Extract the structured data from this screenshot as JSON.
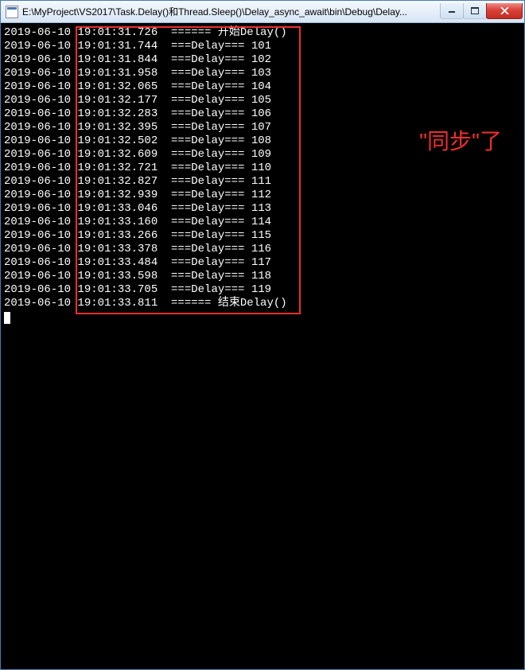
{
  "window": {
    "title": "E:\\MyProject\\VS2017\\Task.Delay()和Thread.Sleep()\\Delay_async_await\\bin\\Debug\\Delay..."
  },
  "annotation": "\"同步\"了",
  "console": {
    "lines": [
      "2019-06-10 19:01:31.726  ====== 开始Delay()",
      "2019-06-10 19:01:31.744  ===Delay=== 101",
      "2019-06-10 19:01:31.844  ===Delay=== 102",
      "2019-06-10 19:01:31.958  ===Delay=== 103",
      "2019-06-10 19:01:32.065  ===Delay=== 104",
      "2019-06-10 19:01:32.177  ===Delay=== 105",
      "2019-06-10 19:01:32.283  ===Delay=== 106",
      "2019-06-10 19:01:32.395  ===Delay=== 107",
      "2019-06-10 19:01:32.502  ===Delay=== 108",
      "2019-06-10 19:01:32.609  ===Delay=== 109",
      "2019-06-10 19:01:32.721  ===Delay=== 110",
      "2019-06-10 19:01:32.827  ===Delay=== 111",
      "2019-06-10 19:01:32.939  ===Delay=== 112",
      "2019-06-10 19:01:33.046  ===Delay=== 113",
      "2019-06-10 19:01:33.160  ===Delay=== 114",
      "2019-06-10 19:01:33.266  ===Delay=== 115",
      "2019-06-10 19:01:33.378  ===Delay=== 116",
      "2019-06-10 19:01:33.484  ===Delay=== 117",
      "2019-06-10 19:01:33.598  ===Delay=== 118",
      "2019-06-10 19:01:33.705  ===Delay=== 119",
      "2019-06-10 19:01:33.811  ====== 结束Delay()"
    ]
  }
}
